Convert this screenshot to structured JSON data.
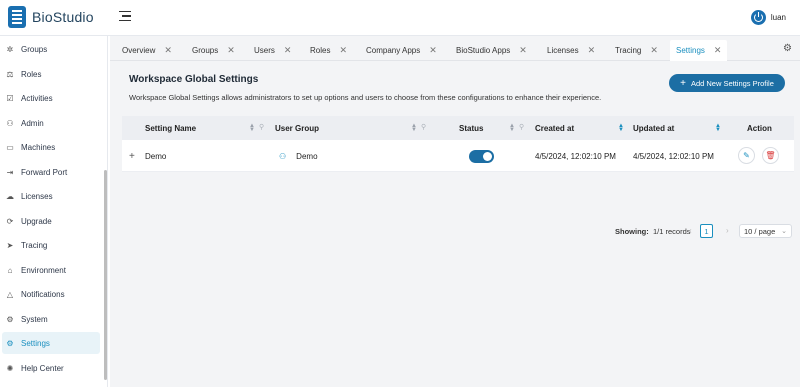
{
  "app": {
    "name": "BioStudio"
  },
  "user": {
    "name": "luan"
  },
  "sidebar": {
    "items": [
      {
        "label": "Groups",
        "icon": "groups-icon"
      },
      {
        "label": "Roles",
        "icon": "roles-icon"
      },
      {
        "label": "Activities",
        "icon": "activities-icon"
      },
      {
        "label": "Admin",
        "icon": "admin-icon"
      },
      {
        "label": "Machines",
        "icon": "machines-icon"
      },
      {
        "label": "Forward Port",
        "icon": "forward-port-icon"
      },
      {
        "label": "Licenses",
        "icon": "licenses-icon"
      },
      {
        "label": "Upgrade",
        "icon": "upgrade-icon"
      },
      {
        "label": "Tracing",
        "icon": "tracing-icon"
      },
      {
        "label": "Environment",
        "icon": "environment-icon"
      },
      {
        "label": "Notifications",
        "icon": "bell-icon"
      },
      {
        "label": "System",
        "icon": "gear-icon"
      },
      {
        "label": "Settings",
        "icon": "settings-icon",
        "active": true
      },
      {
        "label": "Help Center",
        "icon": "help-icon"
      }
    ]
  },
  "tabs": [
    {
      "label": "Overview"
    },
    {
      "label": "Groups"
    },
    {
      "label": "Users"
    },
    {
      "label": "Roles"
    },
    {
      "label": "Company Apps"
    },
    {
      "label": "BioStudio Apps"
    },
    {
      "label": "Licenses"
    },
    {
      "label": "Tracing"
    },
    {
      "label": "Settings",
      "active": true
    }
  ],
  "panel": {
    "title": "Workspace Global Settings",
    "description": "Workspace Global Settings allows administrators to set up options and users to choose from these configurations to enhance their experience.",
    "add_button": "Add New Settings Profile"
  },
  "table": {
    "columns": [
      "Setting Name",
      "User Group",
      "Status",
      "Created at",
      "Updated at",
      "Action"
    ],
    "rows": [
      {
        "expand": "+",
        "name": "Demo",
        "group": "Demo",
        "status": true,
        "created": "4/5/2024, 12:02:10 PM",
        "updated": "4/5/2024, 12:02:10 PM"
      }
    ]
  },
  "pagination": {
    "showing_label": "Showing:",
    "showing_value": "1/1 records",
    "current_page": "1",
    "page_size": "10 / page"
  },
  "colors": {
    "accent": "#1a8fbf",
    "primary_button": "#1c6ea4",
    "brand": "#1a6fb0"
  }
}
